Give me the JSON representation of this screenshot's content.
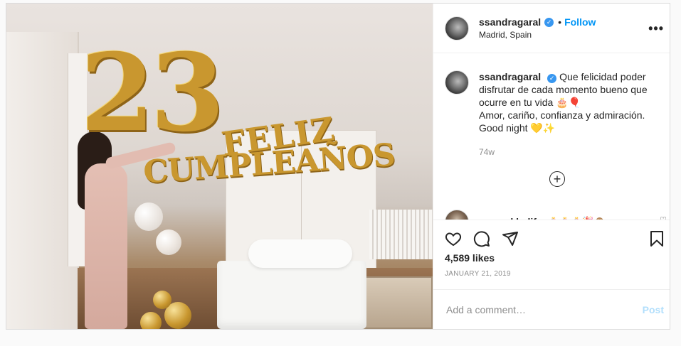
{
  "photo": {
    "balloon_number": "23",
    "balloon_line1": "FELIZ",
    "balloon_line2": "CUMPLEAÑOS",
    "colors": {
      "gold": "#c9972f",
      "wall": "#e6e0db",
      "floor": "#7a573a"
    }
  },
  "header": {
    "username": "ssandragaral",
    "dot": "•",
    "follow_label": "Follow",
    "location": "Madrid, Spain",
    "more_label": "•••"
  },
  "caption": {
    "username": "ssandragaral",
    "text_line1": "Que felicidad poder disfrutar de cada momento bueno que ocurre en tu vida 🎂🎈",
    "text_line2": "Amor, cariño, confianza y admiración.",
    "text_line3": "Good night 💛✨",
    "time_ago": "74w"
  },
  "load_more_icon": "plus-circle-icon",
  "comment": {
    "username": "mo_a_khalifa",
    "text": "🎂🎂🎂🎉🙈"
  },
  "actions": {
    "icons": [
      "heart-icon",
      "comment-icon",
      "share-icon",
      "bookmark-icon"
    ]
  },
  "likes": "4,589 likes",
  "date": "JANUARY 21, 2019",
  "add_comment": {
    "placeholder": "Add a comment…",
    "post_label": "Post"
  },
  "colors": {
    "accent": "#0095f6",
    "verified": "#3897f0",
    "post_disabled": "#b2dffc",
    "muted": "#8e8e8e"
  }
}
